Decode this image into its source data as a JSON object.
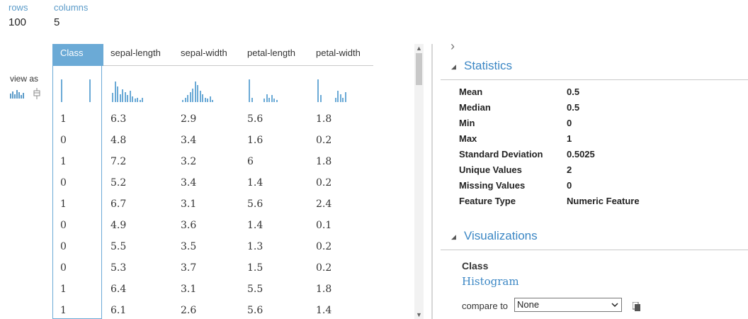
{
  "meta": {
    "rows_label": "rows",
    "rows_value": "100",
    "columns_label": "columns",
    "columns_value": "5"
  },
  "view_as_label": "view as",
  "columns": [
    "Class",
    "sepal-length",
    "sepal-width",
    "petal-length",
    "petal-width"
  ],
  "rows": [
    [
      "1",
      "6.3",
      "2.9",
      "5.6",
      "1.8"
    ],
    [
      "0",
      "4.8",
      "3.4",
      "1.6",
      "0.2"
    ],
    [
      "1",
      "7.2",
      "3.2",
      "6",
      "1.8"
    ],
    [
      "0",
      "5.2",
      "3.4",
      "1.4",
      "0.2"
    ],
    [
      "1",
      "6.7",
      "3.1",
      "5.6",
      "2.4"
    ],
    [
      "0",
      "4.9",
      "3.6",
      "1.4",
      "0.1"
    ],
    [
      "0",
      "5.5",
      "3.5",
      "1.3",
      "0.2"
    ],
    [
      "0",
      "5.3",
      "3.7",
      "1.5",
      "0.2"
    ],
    [
      "1",
      "6.4",
      "3.1",
      "5.5",
      "1.8"
    ],
    [
      "1",
      "6.1",
      "2.6",
      "5.6",
      "1.4"
    ]
  ],
  "mini_histograms": [
    [
      1,
      0,
      0,
      0,
      0,
      0,
      0,
      0,
      0,
      0,
      0,
      0,
      0,
      1
    ],
    [
      0.4,
      0.9,
      0.7,
      0.35,
      0.55,
      0.45,
      0.3,
      0.5,
      0.25,
      0.15,
      0.2,
      0.1,
      0.2
    ],
    [
      0.1,
      0.2,
      0.3,
      0.45,
      0.6,
      0.9,
      0.75,
      0.5,
      0.35,
      0.2,
      0.15,
      0.25,
      0.1
    ],
    [
      1,
      0.2,
      0,
      0,
      0,
      0,
      0.15,
      0.35,
      0.2,
      0.3,
      0.15,
      0.1
    ],
    [
      1,
      0.3,
      0,
      0,
      0,
      0,
      0,
      0.2,
      0.5,
      0.35,
      0.2,
      0.45
    ]
  ],
  "panel": {
    "expand_glyph": "›",
    "statistics_title": "Statistics",
    "stats": [
      {
        "name": "Mean",
        "value": "0.5"
      },
      {
        "name": "Median",
        "value": "0.5"
      },
      {
        "name": "Min",
        "value": "0"
      },
      {
        "name": "Max",
        "value": "1"
      },
      {
        "name": "Standard Deviation",
        "value": "0.5025"
      },
      {
        "name": "Unique Values",
        "value": "2"
      },
      {
        "name": "Missing Values",
        "value": "0"
      },
      {
        "name": "Feature Type",
        "value": "Numeric Feature"
      }
    ],
    "visualizations_title": "Visualizations",
    "viz_feature": "Class",
    "viz_type": "Histogram",
    "compare_label": "compare to",
    "compare_value": "None"
  },
  "colors": {
    "accent": "#6baad6",
    "title": "#3a86c4",
    "label": "#5b9bc9"
  }
}
